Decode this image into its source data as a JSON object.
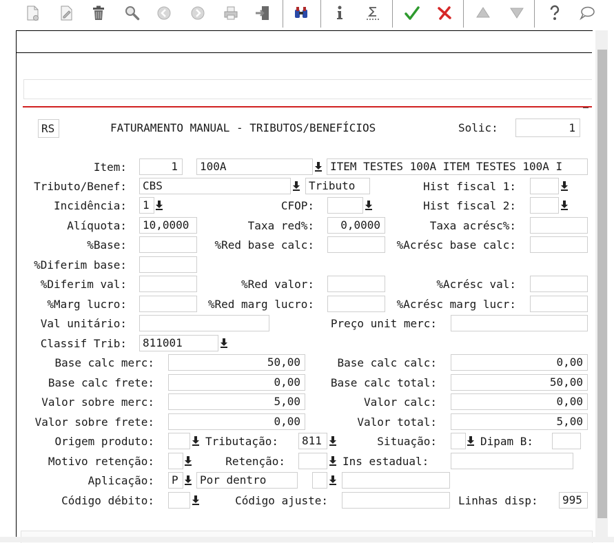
{
  "form": {
    "uf": "RS",
    "title": "FATURAMENTO MANUAL - TRIBUTOS/BENEFÍCIOS",
    "solic_label": "Solic:",
    "solic_value": "1",
    "item_label": "Item:",
    "item_seq": "1",
    "item_code": "100A",
    "item_desc": "ITEM TESTES 100A ITEM TESTES 100A I",
    "tributo_label": "Tributo/Benef:",
    "tributo_value": "CBS",
    "tributo_type": "Tributo",
    "hist1_label": "Hist fiscal 1:",
    "incidencia_label": "Incidência:",
    "incidencia_value": "1",
    "cfop_label": "CFOP:",
    "hist2_label": "Hist fiscal 2:",
    "aliquota_label": "Alíquota:",
    "aliquota_value": "10,0000",
    "taxa_red_label": "Taxa red%:",
    "taxa_red_value": "0,0000",
    "taxa_acresc_label": "Taxa acrésc%:",
    "base_pct_label": "%Base:",
    "red_base_calc_label": "%Red base calc:",
    "acresc_base_calc_label": "%Acrésc base calc:",
    "diferim_base_label": "%Diferim base:",
    "diferim_val_label": "%Diferim val:",
    "red_valor_label": "%Red valor:",
    "acresc_val_label": "%Acrésc val:",
    "marg_lucro_label": "%Marg lucro:",
    "red_marg_lucro_label": "%Red marg lucro:",
    "acresc_marg_lucr_label": "%Acrésc marg lucr:",
    "val_unit_label": "Val unitário:",
    "preco_unit_label": "Preço unit merc:",
    "classif_label": "Classif Trib:",
    "classif_value": "811001",
    "base_calc_merc_label": "Base calc merc:",
    "base_calc_merc_value": "50,00",
    "base_calc_calc_label": "Base calc calc:",
    "base_calc_calc_value": "0,00",
    "base_calc_frete_label": "Base calc frete:",
    "base_calc_frete_value": "0,00",
    "base_calc_total_label": "Base calc total:",
    "base_calc_total_value": "50,00",
    "valor_sobre_merc_label": "Valor sobre merc:",
    "valor_sobre_merc_value": "5,00",
    "valor_calc_label": "Valor calc:",
    "valor_calc_value": "0,00",
    "valor_sobre_frete_label": "Valor sobre frete:",
    "valor_sobre_frete_value": "0,00",
    "valor_total_label": "Valor total:",
    "valor_total_value": "5,00",
    "origem_label": "Origem produto:",
    "tributacao_label": "Tributação:",
    "tributacao_value": "811",
    "situacao_label": "Situação:",
    "dipam_label": "Dipam B:",
    "motivo_label": "Motivo retenção:",
    "retencao_label": "Retenção:",
    "ins_estadual_label": "Ins estadual:",
    "aplicacao_label": "Aplicação:",
    "aplicacao_code": "P",
    "aplicacao_desc": "Por dentro",
    "cod_debito_label": "Código débito:",
    "cod_ajuste_label": "Código ajuste:",
    "linhas_label": "Linhas disp:",
    "linhas_value": "995"
  },
  "icons": {
    "accent_green": "#2e9a2e",
    "accent_red": "#d62828",
    "accent_blue": "#2a4aa8"
  }
}
